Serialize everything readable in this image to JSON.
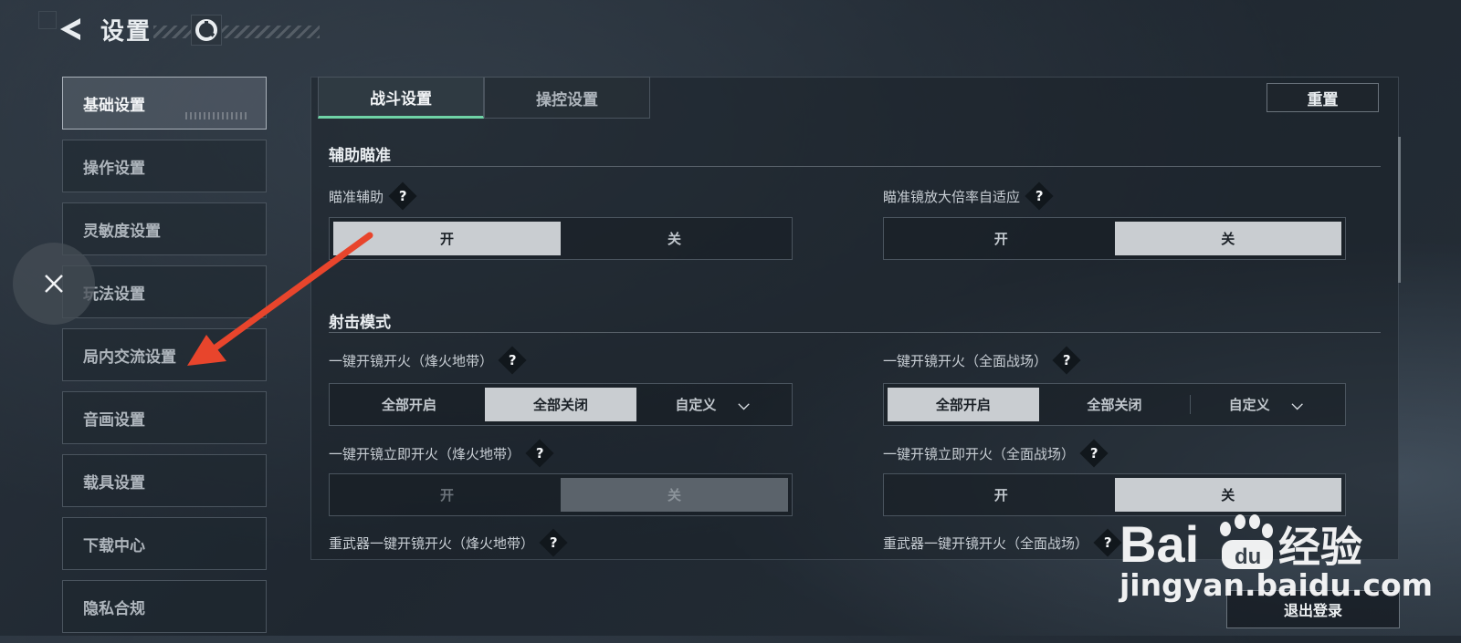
{
  "header": {
    "title": "设置"
  },
  "sidebar": {
    "items": [
      {
        "label": "基础设置",
        "active": true
      },
      {
        "label": "操作设置"
      },
      {
        "label": "灵敏度设置"
      },
      {
        "label": "玩法设置"
      },
      {
        "label": "局内交流设置"
      },
      {
        "label": "音画设置"
      },
      {
        "label": "载具设置"
      },
      {
        "label": "下载中心"
      },
      {
        "label": "隐私合规"
      }
    ]
  },
  "tabs": [
    {
      "label": "战斗设置",
      "active": true
    },
    {
      "label": "操控设置"
    }
  ],
  "reset_label": "重置",
  "sections": [
    {
      "title": "辅助瞄准",
      "settings": [
        {
          "label": "瞄准辅助",
          "options": [
            "开",
            "关"
          ],
          "selected": "开"
        },
        {
          "label": "瞄准镜放大倍率自适应",
          "options": [
            "开",
            "关"
          ],
          "selected": "关"
        }
      ]
    },
    {
      "title": "射击模式",
      "settings": [
        {
          "label": "一键开镜开火（烽火地带）",
          "options": [
            "全部开启",
            "全部关闭",
            "自定义"
          ],
          "selected": "全部关闭"
        },
        {
          "label": "一键开镜开火（全面战场）",
          "options": [
            "全部开启",
            "全部关闭",
            "自定义"
          ],
          "selected": "全部开启"
        },
        {
          "label": "一键开镜立即开火（烽火地带）",
          "options": [
            "开",
            "关"
          ],
          "selected": "关",
          "disabled": true
        },
        {
          "label": "一键开镜立即开火（全面战场）",
          "options": [
            "开",
            "关"
          ],
          "selected": "关"
        },
        {
          "label": "重武器一键开镜开火（烽火地带）"
        },
        {
          "label": "重武器一键开镜开火（全面战场）"
        }
      ]
    }
  ],
  "logout_label": "退出登录",
  "watermark": {
    "brand": "Bai",
    "brand2": "经验",
    "url": "jingyan.baidu.com"
  },
  "colors": {
    "accent": "#6fd3a6",
    "annotation_arrow": "#e8452c",
    "selected_option": "#c9cdd1"
  }
}
